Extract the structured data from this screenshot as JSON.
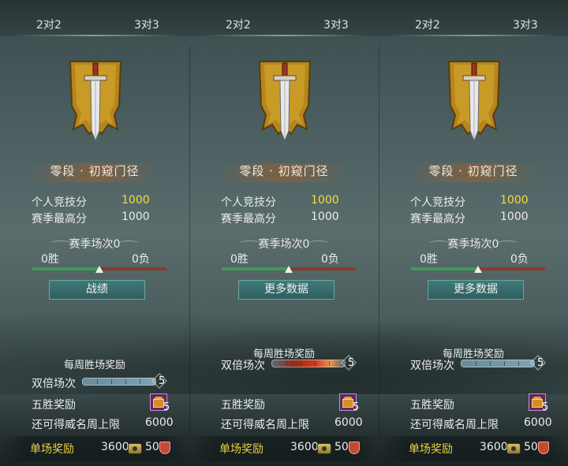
{
  "panels": [
    {
      "tabs": [
        "2对2",
        "3对3"
      ],
      "rank": "零段 · 初窥门径",
      "personal_label": "个人竞技分",
      "personal_value": "1000",
      "season_best_label": "赛季最高分",
      "season_best_value": "1000",
      "season_matches": "赛季场次0",
      "wins": "0胜",
      "losses": "0负",
      "button": "战绩",
      "weekly_title": "每周胜场奖励",
      "double_label": "双倍场次",
      "double_count": "5",
      "five_win_label": "五胜奖励",
      "chest_count": "5",
      "fame_label": "还可得威名周上限",
      "fame_value": "6000",
      "single_label": "单场奖励",
      "coin_value": "3600",
      "shield_value": "50"
    },
    {
      "tabs": [
        "2对2",
        "3对3"
      ],
      "rank": "零段 · 初窥门径",
      "personal_label": "个人竞技分",
      "personal_value": "1000",
      "season_best_label": "赛季最高分",
      "season_best_value": "1000",
      "season_matches": "赛季场次0",
      "wins": "0胜",
      "losses": "0负",
      "button": "更多数据",
      "weekly_title": "每周胜场奖励",
      "double_label": "双倍场次",
      "double_count": "5",
      "five_win_label": "五胜奖励",
      "chest_count": "5",
      "fame_label": "还可得威名周上限",
      "fame_value": "6000",
      "single_label": "单场奖励",
      "coin_value": "3600",
      "shield_value": "50"
    },
    {
      "tabs": [
        "2对2",
        "3对3"
      ],
      "rank": "零段 · 初窥门径",
      "personal_label": "个人竞技分",
      "personal_value": "1000",
      "season_best_label": "赛季最高分",
      "season_best_value": "1000",
      "season_matches": "赛季场次0",
      "wins": "0胜",
      "losses": "0负",
      "button": "更多数据",
      "weekly_title": "每周胜场奖励",
      "double_label": "双倍场次",
      "double_count": "5",
      "five_win_label": "五胜奖励",
      "chest_count": "5",
      "fame_label": "还可得威名周上限",
      "fame_value": "6000",
      "single_label": "单场奖励",
      "coin_value": "3600",
      "shield_value": "50"
    }
  ],
  "colors": {
    "gold": "#f3df3f",
    "button": "#3f7b79",
    "win_bar": "#3f9a5a",
    "loss_bar": "#8a3a2c"
  },
  "icons": [
    "sword-banner-emblem",
    "treasure-chest-icon",
    "coin-icon",
    "shield-icon"
  ]
}
